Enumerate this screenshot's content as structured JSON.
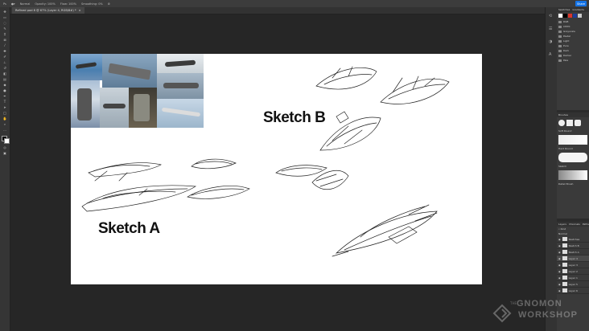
{
  "optionsbar": {
    "mode": "Normal",
    "opacity": "Opacity: 100%",
    "flow": "Flow: 100%",
    "smoothing": "Smoothing: 0%",
    "share": "Share"
  },
  "document": {
    "tab_title": "Refined pad 8 @ 67% (Layer 4, RGB/8#) *"
  },
  "canvas": {
    "sketch_a_label": "Sketch A",
    "sketch_b_label": "Sketch B"
  },
  "swatches_panel": {
    "tabs": [
      "Swatches",
      "Gradients"
    ],
    "colors": [
      "#ffffff",
      "#000000",
      "#d9342b",
      "#1f3d99",
      "#c8c8c8"
    ],
    "groups": [
      "RGB",
      "CMYK",
      "Grayscale",
      "Pastel",
      "Light",
      "Pure",
      "Dark",
      "Darker",
      "Pale"
    ]
  },
  "brushes_panel": {
    "title": "Brushes",
    "items": [
      "Soft Round",
      "Hard Round",
      "Sketch",
      "Detail Brush"
    ]
  },
  "layers_panel": {
    "tabs": [
      "Layers",
      "Channels",
      "Paths"
    ],
    "kind": "Kind",
    "blend": "Normal",
    "layers": [
      "Sketches",
      "Sketch B",
      "Sketch A",
      "Layer 4",
      "Layer 3",
      "Layer 2",
      "Layer 1",
      "Layer 5",
      "Layer 6"
    ]
  },
  "watermark": {
    "small": "THE",
    "line1": "GNOMON",
    "line2": "WORKSHOP"
  }
}
